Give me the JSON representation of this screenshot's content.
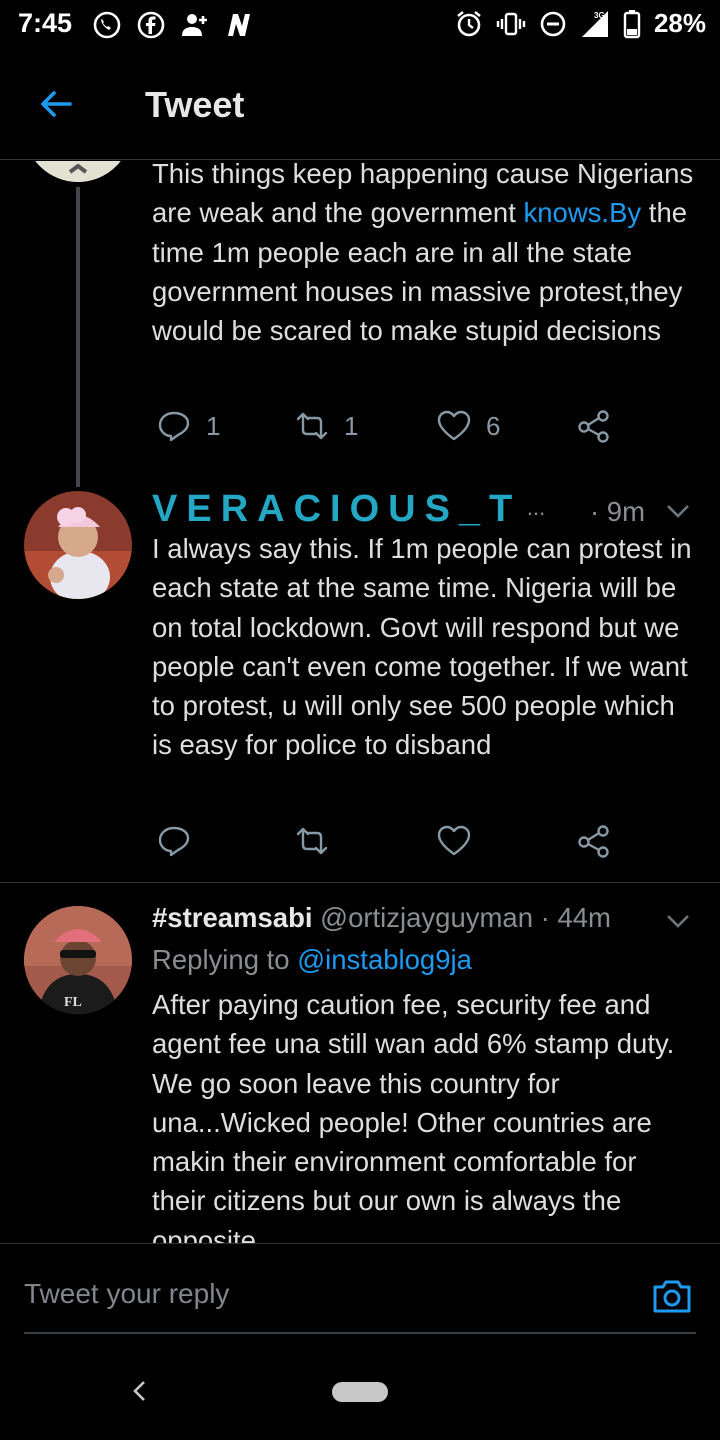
{
  "status_bar": {
    "time": "7:45",
    "left_icons": [
      "whatsapp-icon",
      "facebook-icon",
      "add-contact-icon",
      "n-app-icon"
    ],
    "right_icons": [
      "alarm-icon",
      "vibrate-icon",
      "dnd-icon",
      "signal-3g-icon",
      "battery-icon"
    ],
    "network": "3G",
    "battery": "28%"
  },
  "header": {
    "title": "Tweet",
    "accent": "#1d9bf0"
  },
  "tweets": [
    {
      "text_before_link": "This things keep happening cause Nigerians are weak and the government ",
      "link": "knows.By",
      "text_after_link": " the time 1m people each are in all the state government houses in massive protest,they would be scared to make stupid decisions",
      "replies": "1",
      "retweets": "1",
      "likes": "6"
    },
    {
      "display_name": "VERACIOUS_T",
      "ellipsis": "...",
      "time": "· 9m",
      "text": "I always say this. If 1m people can protest in each state at the same time. Nigeria will be on total lockdown. Govt will respond but we people can't even come together. If we want to protest, u will only see 500 people which is easy for police to disband"
    },
    {
      "display_name": "#streamsabi",
      "handle": "@ortizjayguyman",
      "time": "· 44m",
      "replying_label": "Replying to",
      "replying_handle": "@instablog9ja",
      "text": "After paying caution fee, security fee and agent fee una still wan add 6% stamp duty. We go soon leave this country for una...Wicked people! Other countries are makin their environment comfortable for their citizens but our own is always the opposite"
    }
  ],
  "reply_bar": {
    "placeholder": "Tweet your reply"
  }
}
